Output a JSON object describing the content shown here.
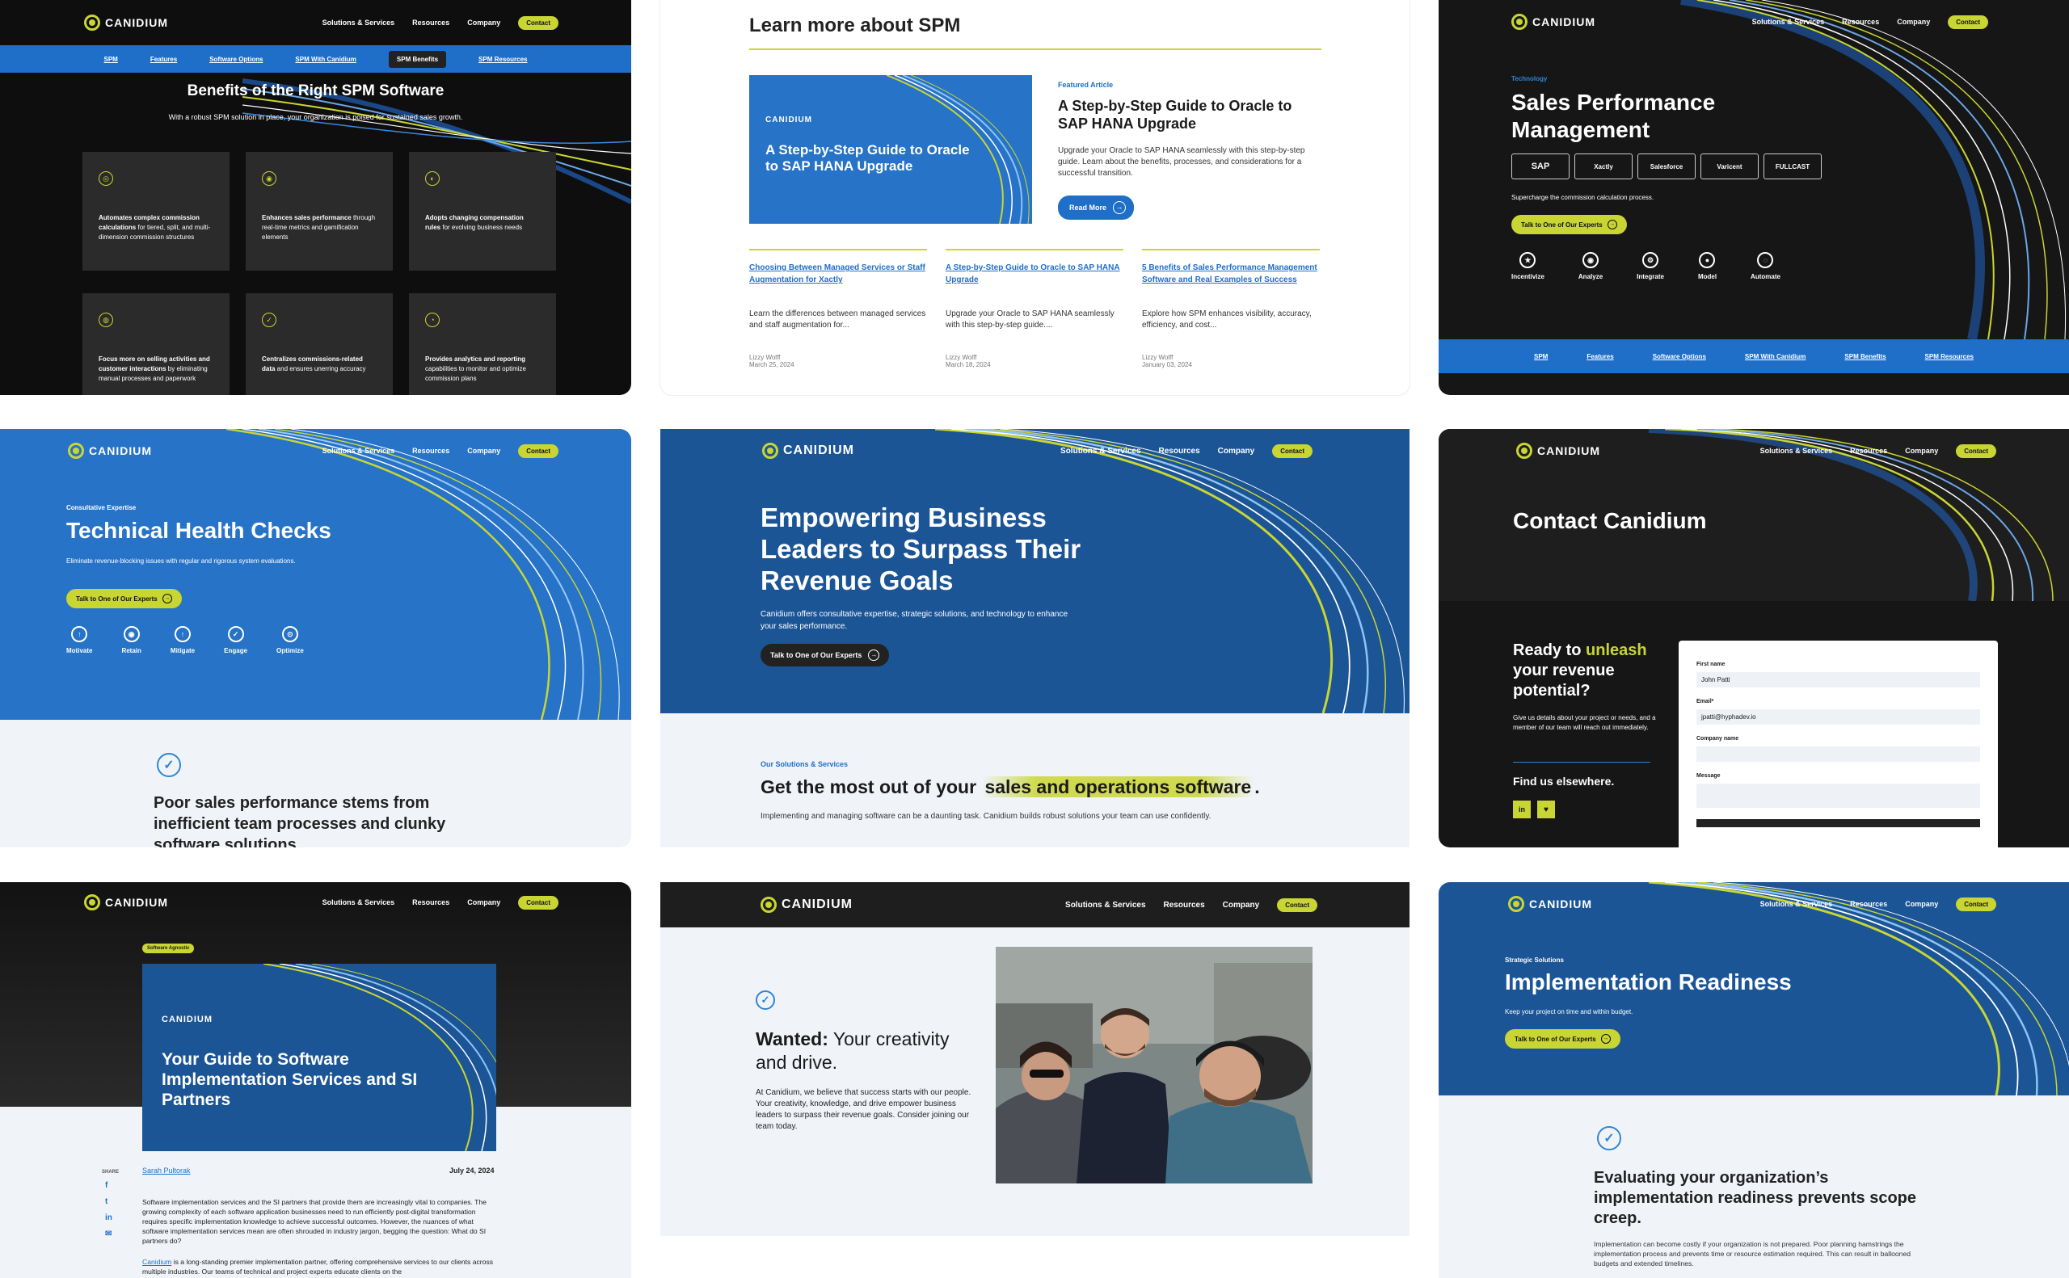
{
  "nav": {
    "logo": "CANIDIUM",
    "solutions": "Solutions & Services",
    "resources": "Resources",
    "company": "Company",
    "contact": "Contact"
  },
  "t1": {
    "subnav": [
      "SPM",
      "Features",
      "Software Options",
      "SPM With Canidium",
      "SPM Benefits",
      "SPM Resources"
    ],
    "title": "Benefits of the Right SPM Software",
    "subtitle": "With a robust SPM solution in place, your organization is poised for sustained sales growth.",
    "cards": [
      {
        "bold": "Automates complex commission calculations",
        "rest": " for tiered, split, and multi-dimension commission structures"
      },
      {
        "bold": "Enhances sales performance",
        "rest": " through real-time metrics and gamification elements"
      },
      {
        "bold": "Adopts changing compensation rules",
        "rest": " for evolving business needs"
      },
      {
        "bold": "Focus more on selling activities and customer interactions",
        "rest": " by eliminating manual processes and paperwork"
      },
      {
        "bold": "Centralizes commissions-related data",
        "rest": " and ensures unerring accuracy"
      },
      {
        "bold": "Provides analytics and reporting",
        "rest": " capabilities to monitor and optimize commission plans"
      }
    ]
  },
  "t2": {
    "heading": "Learn more about SPM",
    "feat_img_logo": "CANIDIUM",
    "feat_img_title": "A Step-by-Step Guide to Oracle to SAP HANA Upgrade",
    "featured_label": "Featured Article",
    "featured_title": "A Step-by-Step Guide to Oracle to SAP HANA Upgrade",
    "featured_desc": "Upgrade your Oracle to SAP HANA seamlessly with this step-by-step guide. Learn about the benefits, processes, and considerations for a successful transition.",
    "read_more": "Read More",
    "articles": [
      {
        "title": "Choosing Between Managed Services or Staff Augmentation for Xactly",
        "desc": "Learn the differences between managed services and staff augmentation for...",
        "author": "Lizzy Wolff",
        "date": "March 25, 2024"
      },
      {
        "title": "A Step-by-Step Guide to Oracle to SAP HANA Upgrade",
        "desc": "Upgrade your Oracle to SAP HANA seamlessly with this step-by-step guide....",
        "author": "Lizzy Wolff",
        "date": "March 18, 2024"
      },
      {
        "title": "5 Benefits of Sales Performance Management Software and Real Examples of Success",
        "desc": "Explore how SPM enhances visibility, accuracy, efficiency, and cost...",
        "author": "Lizzy Wolff",
        "date": "January 03, 2024"
      }
    ]
  },
  "t3": {
    "eyebrow": "Technology",
    "title": "Sales Performance Management",
    "partners": [
      "SAP",
      "Xactly",
      "Salesforce",
      "Varicent",
      "FULLCAST"
    ],
    "desc": "Supercharge the commission calculation process.",
    "cta": "Talk to One of Our Experts",
    "icons": [
      "Incentivize",
      "Analyze",
      "Integrate",
      "Model",
      "Automate"
    ],
    "subnav": [
      "SPM",
      "Features",
      "Software Options",
      "SPM With Canidium",
      "SPM Benefits",
      "SPM Resources"
    ]
  },
  "t4": {
    "eyebrow": "Consultative Expertise",
    "title": "Technical Health Checks",
    "desc": "Eliminate revenue-blocking issues with regular and rigorous system evaluations.",
    "cta": "Talk to One of Our Experts",
    "icons": [
      "Motivate",
      "Retain",
      "Mitigate",
      "Engage",
      "Optimize"
    ],
    "body": "Poor sales performance stems from inefficient team processes and clunky software solutions."
  },
  "t5": {
    "title": "Empowering Business Leaders to Surpass Their Revenue Goals",
    "desc": "Canidium offers consultative expertise, strategic solutions, and technology to enhance your sales performance.",
    "cta": "Talk to One of Our Experts",
    "eyebrow": "Our Solutions & Services",
    "h2_pre": "Get the most out of your ",
    "h2_hl": "sales and operations software",
    "h2_post": ".",
    "p": "Implementing and managing software can be a daunting task. Canidium builds robust solutions your team can use confidently."
  },
  "t6": {
    "title": "Contact Canidium",
    "ready_pre": "Ready to ",
    "ready_hl": "unleash",
    "ready_post": " your revenue potential?",
    "desc": "Give us details about your project or needs, and a member of our team will reach out immediately.",
    "find": "Find us elsewhere.",
    "form": {
      "first_label": "First name",
      "first_value": "John Patti",
      "email_label": "Email*",
      "email_value": "jpatti@hyphadev.io",
      "company_label": "Company name",
      "message_label": "Message"
    }
  },
  "t7": {
    "badge": "Software Agnostic",
    "img_logo": "CANIDIUM",
    "img_title": "Your Guide to Software Implementation Services and SI Partners",
    "share": "SHARE",
    "author": "Sarah Pultorak",
    "date": "July 24, 2024",
    "p1": "Software implementation services and the SI partners that provide them are increasingly vital to companies. The growing complexity of each software application businesses need to run efficiently post-digital transformation requires specific implementation knowledge to achieve successful outcomes. However, the nuances of what software implementation services mean are often shrouded in industry jargon, begging the question: What do SI partners do?",
    "p2_link": "Canidium",
    "p2": " is a long-standing premier implementation partner, offering comprehensive services to our clients across multiple industries. Our teams of technical and project experts educate clients on the"
  },
  "t8": {
    "h_bold": "Wanted:",
    "h_rest": " Your creativity and drive.",
    "p": "At Canidium, we believe that success starts with our people. Your creativity, knowledge, and drive empower business leaders to surpass their revenue goals. Consider joining our team today."
  },
  "t9": {
    "eyebrow": "Strategic Solutions",
    "title": "Implementation Readiness",
    "desc": "Keep your project on time and within budget.",
    "cta": "Talk to One of Our Experts",
    "h2": "Evaluating your organization’s implementation readiness prevents scope creep.",
    "p": "Implementation can become costly if your organization is not prepared. Poor planning hamstrings the implementation process and prevents time or resource estimation required. This can result in ballooned budgets and extended timelines."
  }
}
